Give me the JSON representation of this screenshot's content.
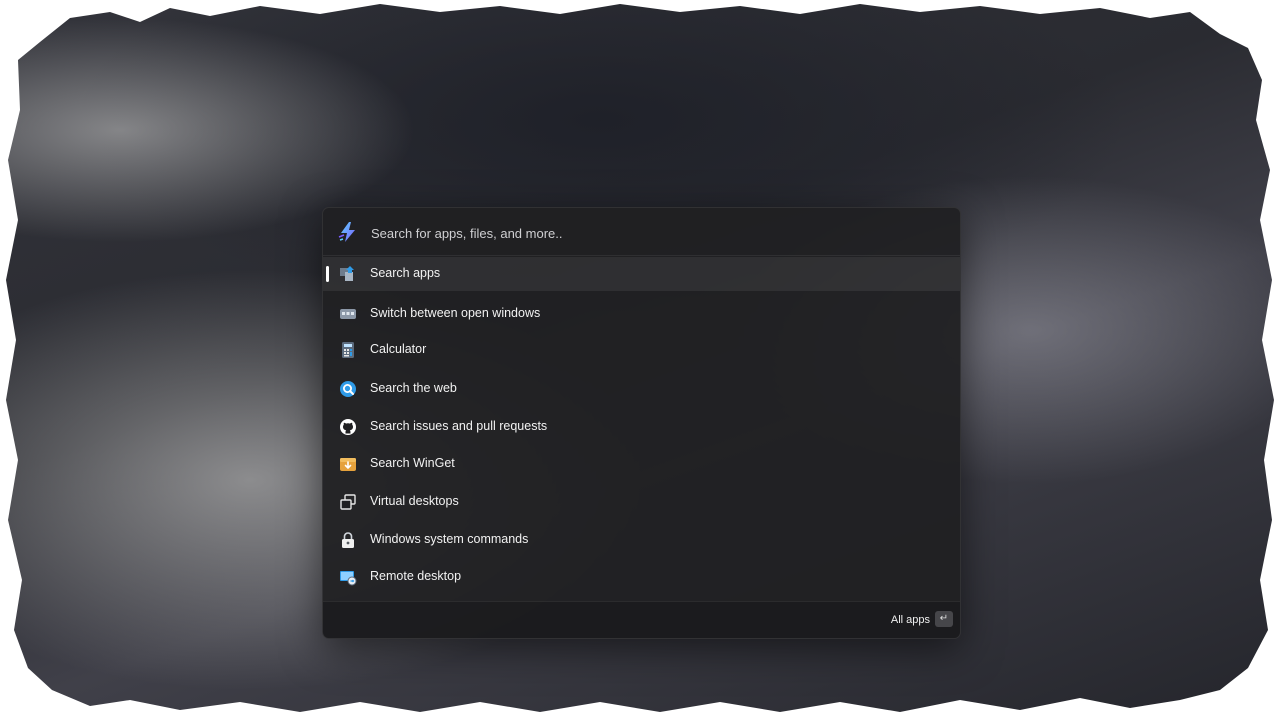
{
  "search": {
    "placeholder": "Search for apps, files, and more.."
  },
  "results": [
    {
      "label": "Search apps",
      "icon": "search-apps-icon",
      "selected": true
    },
    {
      "label": "Switch between open windows",
      "icon": "window-walker-icon",
      "selected": false
    },
    {
      "label": "Calculator",
      "icon": "calculator-icon",
      "selected": false
    },
    {
      "label": "Search the web",
      "icon": "web-search-icon",
      "selected": false
    },
    {
      "label": "Search issues and pull requests",
      "icon": "github-icon",
      "selected": false
    },
    {
      "label": "Search WinGet",
      "icon": "winget-icon",
      "selected": false
    },
    {
      "label": "Virtual desktops",
      "icon": "virtual-desktops-icon",
      "selected": false
    },
    {
      "label": "Windows system commands",
      "icon": "lock-icon",
      "selected": false
    },
    {
      "label": "Remote desktop",
      "icon": "remote-desktop-icon",
      "selected": false
    }
  ],
  "footer": {
    "action_label": "All apps",
    "key_hint": "↵"
  },
  "colors": {
    "panel": "#202022",
    "accent_blue": "#2f9be8",
    "winget_orange": "#e6a23c",
    "launcher_purple": "#7b5cff"
  }
}
